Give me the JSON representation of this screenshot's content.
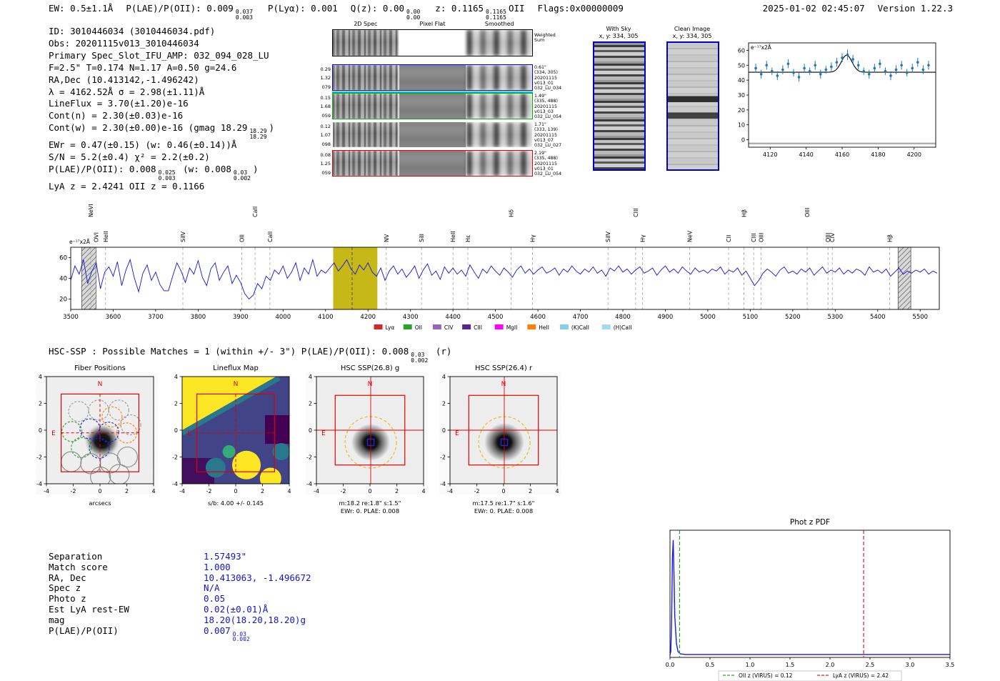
{
  "meta": {
    "timestamp": "2025-01-02 02:45:07",
    "version": "Version 1.22.3"
  },
  "palette": {
    "annotation_red": "#e00000",
    "box_blue": "#0000cc",
    "value_blue": "#1414cc",
    "band_yellow": "#c5b817",
    "oii_green": "#2ca02c",
    "lya_red": "#d62728"
  },
  "header": {
    "ew": "EW: 0.5±1.1Å",
    "plae": "P(LAE)/P(OII): 0.009",
    "plae_sup": "0.037",
    "plae_sub": "0.003",
    "plya": "P(Lyα): 0.001",
    "qz": "Q(z): 0.00",
    "qz_sup": "0.00",
    "qz_sub": "0.00",
    "z": "z: 0.1165",
    "z_sup": "0.1165",
    "z_sub": "0.1165",
    "z_type": "OII",
    "flags": "Flags:0x00000009"
  },
  "info": {
    "id": "ID: 3010446034 (3010446034.pdf)",
    "obs": "Obs: 20201115v013_3010446034",
    "primary": "Primary Spec_Slot_IFU_AMP: 032_094_028_LU",
    "photometry": "F=2.5\"  T=0.174  N=1.17  A=0.50  g=24.6",
    "radec": "RA,Dec (10.413142,-1.496242)",
    "lambda": "λ = 4162.52Å  σ = 2.98(±1.11)Å",
    "lineflux": "LineFlux = 3.70(±1.20)e-16",
    "cont_n": "Cont(n) = 2.30(±0.03)e-16",
    "cont_w": "Cont(w) = 2.30(±0.00)e-16 (gmag 18.29",
    "cont_w_sup": "18.29",
    "cont_w_sub": "18.29",
    "cont_w_close": ")",
    "ewr": "EWr = 0.47(±0.15) (w: 0.46(±0.14))Å",
    "sn": "S/N = 5.2(±0.4)   χ² = 2.2(±0.2)",
    "plae1": "P(LAE)/P(OII): 0.008",
    "plae1_sup": "0.025",
    "plae1_sub": "0.003",
    "plae2": "(w: 0.008",
    "plae2_sup": "0.03",
    "plae2_sub": "0.002",
    "plae2_close": ")",
    "redshifts": "LyA z = 2.4241  OII z = 0.1166"
  },
  "spec2d": {
    "col_headers": [
      "2D Spec",
      "Pixel Flat",
      "Smoothed"
    ],
    "weighted_sum": [
      "Weighted",
      "Sum"
    ],
    "rows": [
      {
        "left": [
          "0.29",
          "1.32",
          "079"
        ],
        "right": [
          "0.61\"",
          "(334, 305)",
          "20201115",
          "v013_01",
          "032_LU_034"
        ]
      },
      {
        "left": [
          "0.15",
          "1.68",
          "059"
        ],
        "right": [
          "1.49\"",
          "(335, 488)",
          "20201115",
          "v013_03",
          "032_LU_054"
        ]
      },
      {
        "left": [
          "0.12",
          "1.07",
          "098"
        ],
        "right": [
          "1.71\"",
          "(333, 139)",
          "20201115",
          "v013_07",
          "032_LU_027"
        ]
      },
      {
        "left": [
          "0.08",
          "1.25",
          "059"
        ],
        "right": [
          "2.19\"",
          "(335, 488)",
          "20201115",
          "v013_01",
          "032_LU_054"
        ]
      }
    ]
  },
  "cutout2d": {
    "withsky_title": "With Sky",
    "withsky_xy": "x, y: 334, 305",
    "clean_title": "Clean Image",
    "clean_xy": "x, y: 334, 305"
  },
  "hsc": {
    "line": "HSC-SSP : Possible Matches = 1 (within +/- 3\")  P(LAE)/P(OII): 0.008",
    "sup": "0.03",
    "sub": "0.002",
    "suffix": "(r)"
  },
  "cutouts": {
    "ticks": [
      -4,
      -2,
      0,
      2,
      4
    ],
    "north": "N",
    "east": "E",
    "panels": [
      {
        "title": "Fiber Positions",
        "xlabel": "arcsecs"
      },
      {
        "title": "Lineflux Map",
        "caption1": "s/b: 4.00 +/- 0.145"
      },
      {
        "title": "HSC SSP(26.8) g",
        "caption1": "m:18.2 re:1.8\" s:1.5\"",
        "caption2": "EWr: 0. PLAE: 0.008"
      },
      {
        "title": "HSC SSP(26.4) r",
        "caption1": "m:17.5 re:1.7\" s:1.6\"",
        "caption2": "EWr: 0. PLAE: 0.008"
      }
    ]
  },
  "match": {
    "rows": [
      {
        "label": "Separation",
        "value": "1.57493\""
      },
      {
        "label": "Match score",
        "value": "1.000"
      },
      {
        "label": "RA, Dec",
        "value": "10.413063, -1.496672"
      },
      {
        "label": "Spec z",
        "value": "N/A"
      },
      {
        "label": "Photo z",
        "value": "0.05"
      },
      {
        "label": "Est LyA rest-EW",
        "value": "0.02(±0.01)Å"
      },
      {
        "label": "mag",
        "value": "18.20(18.20,18.20)g"
      },
      {
        "label": "P(LAE)/P(OII)",
        "value": "0.007",
        "sup": "0.03",
        "sub": "0.002"
      }
    ]
  },
  "chart_data": [
    {
      "type": "scatter",
      "name": "line-fit-zoom",
      "corner_label": "e⁻¹⁷x2Å",
      "xlim": [
        4108,
        4212
      ],
      "ylim": [
        -5,
        65
      ],
      "xticks": [
        4120,
        4140,
        4160,
        4180,
        4200
      ],
      "yticks": [
        0,
        10,
        20,
        30,
        40,
        50,
        60
      ],
      "point_color": "#1f77b4",
      "fit_color": "#000000",
      "fit": {
        "base": 45.3,
        "amp": 11.5,
        "center": 4162.5,
        "sigma": 2.98
      },
      "points": [
        [
          4112,
          48,
          3
        ],
        [
          4115,
          44,
          3
        ],
        [
          4118,
          50,
          3
        ],
        [
          4121,
          46,
          2.5
        ],
        [
          4124,
          43,
          3
        ],
        [
          4127,
          47,
          3
        ],
        [
          4130,
          51,
          3
        ],
        [
          4133,
          45,
          2.5
        ],
        [
          4136,
          42,
          3
        ],
        [
          4139,
          48,
          3
        ],
        [
          4142,
          46,
          2.5
        ],
        [
          4145,
          50,
          3
        ],
        [
          4148,
          44,
          3
        ],
        [
          4151,
          47,
          2.5
        ],
        [
          4154,
          49,
          3
        ],
        [
          4157,
          52,
          3
        ],
        [
          4160,
          55,
          3
        ],
        [
          4163,
          57,
          3.5
        ],
        [
          4166,
          54,
          3
        ],
        [
          4169,
          50,
          3
        ],
        [
          4172,
          46,
          2.5
        ],
        [
          4175,
          44,
          3
        ],
        [
          4178,
          48,
          3
        ],
        [
          4181,
          51,
          3
        ],
        [
          4184,
          46,
          2.5
        ],
        [
          4187,
          43,
          3
        ],
        [
          4190,
          47,
          3
        ],
        [
          4193,
          50,
          3
        ],
        [
          4196,
          45,
          2.5
        ],
        [
          4199,
          48,
          3
        ],
        [
          4202,
          52,
          3
        ],
        [
          4205,
          47,
          3
        ],
        [
          4208,
          50,
          3
        ]
      ]
    },
    {
      "type": "line",
      "name": "full-spectrum",
      "corner_label": "e⁻¹⁷x2Å",
      "x_start": 3500,
      "x_step": 10,
      "xlim": [
        3500,
        5545
      ],
      "ylim": [
        10,
        70
      ],
      "xticks": [
        3500,
        3600,
        3700,
        3800,
        3900,
        4000,
        4100,
        4200,
        4300,
        4400,
        4500,
        4600,
        4700,
        4800,
        4900,
        5000,
        5100,
        5200,
        5300,
        5400,
        5500
      ],
      "yticks": [
        20,
        40,
        60
      ],
      "line_color": "#1414d4",
      "band": {
        "x0": 4118,
        "x1": 4222,
        "color": "#c5b817"
      },
      "detect_line": 4162.5,
      "masks": [
        [
          3526,
          3560
        ],
        [
          5448,
          5478
        ]
      ],
      "values": [
        38,
        52,
        44,
        58,
        35,
        47,
        55,
        30,
        46,
        51,
        42,
        56,
        33,
        48,
        58,
        40,
        27,
        45,
        53,
        38,
        46,
        34,
        28,
        28,
        42,
        55,
        47,
        36,
        50,
        44,
        57,
        41,
        33,
        49,
        55,
        38,
        46,
        52,
        35,
        43,
        36,
        25,
        20,
        24,
        35,
        30,
        42,
        38,
        48,
        44,
        52,
        40,
        46,
        55,
        38,
        50,
        44,
        58,
        42,
        48,
        45,
        50,
        55,
        47,
        52,
        58,
        49,
        44,
        53,
        48,
        55,
        46,
        42,
        50,
        38,
        47,
        52,
        44,
        49,
        41,
        46,
        52,
        40,
        48,
        54,
        43,
        47,
        39,
        51,
        45,
        50,
        44,
        48,
        42,
        53,
        46,
        40,
        49,
        45,
        52,
        47,
        43,
        50,
        46,
        41,
        48,
        52,
        45,
        49,
        44,
        48,
        51,
        45,
        47,
        50,
        43,
        49,
        46,
        52,
        47,
        44,
        49,
        46,
        51,
        45,
        48,
        42,
        50,
        47,
        52,
        46,
        49,
        44,
        48,
        51,
        45,
        47,
        50,
        43,
        48,
        52,
        46,
        49,
        45,
        51,
        47,
        44,
        50,
        46,
        48,
        45,
        49,
        47,
        51,
        44,
        48,
        46,
        50,
        43,
        47,
        40,
        33,
        38,
        45,
        49,
        46,
        42,
        48,
        51,
        45,
        47,
        44,
        49,
        46,
        50,
        43,
        47,
        51,
        45,
        48,
        46,
        50,
        44,
        48,
        45,
        49,
        47,
        43,
        51,
        46,
        48,
        45,
        49,
        42,
        46,
        50,
        44,
        47,
        45,
        48,
        46,
        49,
        44,
        47,
        45
      ],
      "lines": [
        {
          "label": "NeVI",
          "wl": 3547,
          "color": "#ff7f0e",
          "tier": 2
        },
        {
          "label": "OVI",
          "wl": 3560,
          "color": "#d62728",
          "tier": 1
        },
        {
          "label": "HeII",
          "wl": 3582,
          "color": "#ff7f0e",
          "tier": 1
        },
        {
          "label": "SiIV",
          "wl": 3764,
          "color": "#9467bd",
          "tier": 1
        },
        {
          "label": "OII",
          "wl": 3903,
          "color": "#ff7f0e",
          "tier": 1
        },
        {
          "label": "CaII",
          "wl": 3934,
          "color": "#87ceeb",
          "tier": 2
        },
        {
          "label": "CaII",
          "wl": 3969,
          "color": "#87ceeb",
          "tier": 1
        },
        {
          "label": "NV",
          "wl": 4243,
          "color": "#d62728",
          "tier": 1
        },
        {
          "label": "SiII",
          "wl": 4326,
          "color": "#d62728",
          "tier": 1
        },
        {
          "label": "HeII",
          "wl": 4400,
          "color": "#ff7f0e",
          "tier": 1
        },
        {
          "label": "Hε",
          "wl": 4435,
          "color": "#9ecae1",
          "tier": 1
        },
        {
          "label": "Hδ",
          "wl": 4537,
          "color": "#9ecae1",
          "tier": 2
        },
        {
          "label": "Hγ",
          "wl": 4587,
          "color": "#9ecae1",
          "tier": 1
        },
        {
          "label": "SiIV",
          "wl": 4765,
          "color": "#2ca02c",
          "tier": 1
        },
        {
          "label": "CIII",
          "wl": 4830,
          "color": "#ff7f0e",
          "tier": 2
        },
        {
          "label": "Hγ",
          "wl": 4846,
          "color": "#2ca02c",
          "tier": 1
        },
        {
          "label": "NeV",
          "wl": 4957,
          "color": "#ff00ff",
          "tier": 1
        },
        {
          "label": "CII",
          "wl": 5049,
          "color": "#9467bd",
          "tier": 1
        },
        {
          "label": "Hβ",
          "wl": 5085,
          "color": "#9ecae1",
          "tier": 2
        },
        {
          "label": "CIII",
          "wl": 5108,
          "color": "#9467bd",
          "tier": 1
        },
        {
          "label": "OIII",
          "wl": 5125,
          "color": "#87ceeb",
          "tier": 1
        },
        {
          "label": "OIII",
          "wl": 5234,
          "color": "#87ceeb",
          "tier": 2
        },
        {
          "label": "OIII",
          "wl": 5283,
          "color": "#87ceeb",
          "tier": 1
        },
        {
          "label": "CIV",
          "wl": 5293,
          "color": "#d62728",
          "tier": 1
        },
        {
          "label": "Hβ",
          "wl": 5428,
          "color": "#2ca02c",
          "tier": 1
        }
      ],
      "legend": [
        {
          "label": "Lyα",
          "color": "#d62728"
        },
        {
          "label": "OII",
          "color": "#2ca02c"
        },
        {
          "label": "CIV",
          "color": "#9467bd"
        },
        {
          "label": "CIII",
          "color": "#54278f"
        },
        {
          "label": "MgII",
          "color": "#ff00ff"
        },
        {
          "label": "HeII",
          "color": "#ff7f0e"
        },
        {
          "label": "(K)CaII",
          "color": "#87ceeb"
        },
        {
          "label": "(H)CaII",
          "color": "#a6d8ef"
        }
      ]
    },
    {
      "type": "line",
      "name": "phot-z-pdf",
      "title": "Phot z PDF",
      "xlim": [
        0,
        3.5
      ],
      "xtick_labels": [
        "0.0",
        "0.5",
        "1.0",
        "1.5",
        "2.0",
        "2.5",
        "3.0",
        "3.5"
      ],
      "curve_color": "#1a1ae6",
      "curve": [
        [
          0,
          0.02
        ],
        [
          0.01,
          0.05
        ],
        [
          0.02,
          0.3
        ],
        [
          0.03,
          0.85
        ],
        [
          0.04,
          1.0
        ],
        [
          0.05,
          0.7
        ],
        [
          0.06,
          0.35
        ],
        [
          0.08,
          0.12
        ],
        [
          0.1,
          0.05
        ],
        [
          0.13,
          0.03
        ],
        [
          0.2,
          0.025
        ],
        [
          0.5,
          0.025
        ],
        [
          1.0,
          0.025
        ],
        [
          1.5,
          0.025
        ],
        [
          2.0,
          0.025
        ],
        [
          2.5,
          0.025
        ],
        [
          3.0,
          0.025
        ],
        [
          3.5,
          0.025
        ]
      ],
      "oii_line": {
        "x": 0.12,
        "color": "#2ca02c",
        "label": "OII z (VIRUS) = 0.12"
      },
      "lya_line": {
        "x": 2.42,
        "color": "#d62728",
        "label": "LyA z (VIRUS) = 2.42"
      }
    }
  ]
}
